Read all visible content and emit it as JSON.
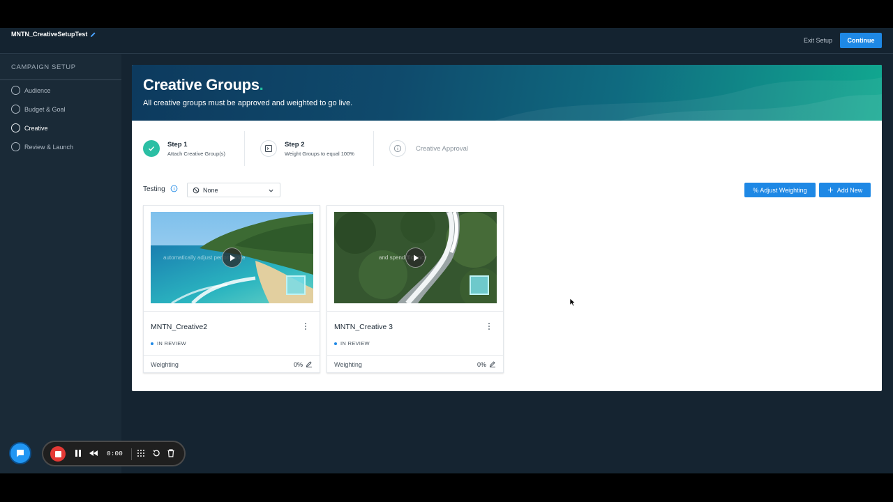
{
  "header": {
    "campaign_name": "MNTN_CreativeSetupTest",
    "exit_label": "Exit Setup",
    "continue_label": "Continue"
  },
  "sidebar": {
    "heading": "CAMPAIGN SETUP",
    "items": [
      {
        "label": "Audience",
        "active": false
      },
      {
        "label": "Budget & Goal",
        "active": false
      },
      {
        "label": "Creative",
        "active": true
      },
      {
        "label": "Review & Launch",
        "active": false
      }
    ]
  },
  "hero": {
    "title": "Creative Groups",
    "title_dot": ".",
    "subtitle": "All creative groups must be approved and weighted to go live."
  },
  "steps": [
    {
      "title": "Step 1",
      "desc": "Attach Creative Group(s)",
      "state": "done",
      "icon": "check-icon"
    },
    {
      "title": "Step 2",
      "desc": "Weight Groups to equal 100%",
      "state": "pending",
      "icon": "terminal-icon"
    },
    {
      "title": "Creative Approval",
      "state": "disabled",
      "icon": "info-icon"
    }
  ],
  "toolbar": {
    "testing_label": "Testing",
    "testing_value": "None",
    "adjust_label": "% Adjust Weighting",
    "add_label": "Add New"
  },
  "creatives": [
    {
      "name": "MNTN_Creative2",
      "status": "IN REVIEW",
      "weighting_label": "Weighting",
      "weighting_value": "0%",
      "overlay_text": "automatically adjust performance"
    },
    {
      "name": "MNTN_Creative 3",
      "status": "IN REVIEW",
      "weighting_label": "Weighting",
      "weighting_value": "0%",
      "overlay_text": "and spend fficiency"
    }
  ],
  "recorder": {
    "time": "0:00"
  },
  "colors": {
    "accent": "#1e88e5",
    "success": "#2bbfa4",
    "sidebar_bg": "#1a2a37",
    "app_bg": "#152431"
  }
}
